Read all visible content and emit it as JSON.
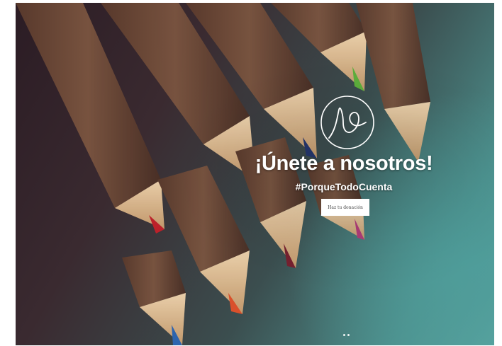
{
  "hero": {
    "headline": "¡Únete a nosotros!",
    "hashtag": "#PorqueTodoCuenta",
    "donate_label": "Haz tu donación",
    "logo_icon": "swirl-logo-icon",
    "slide_count": 2
  },
  "colors": {
    "text": "#ffffff",
    "button_bg": "#ffffff",
    "teal": "#4f9d9a",
    "dark": "#2b1c24"
  }
}
